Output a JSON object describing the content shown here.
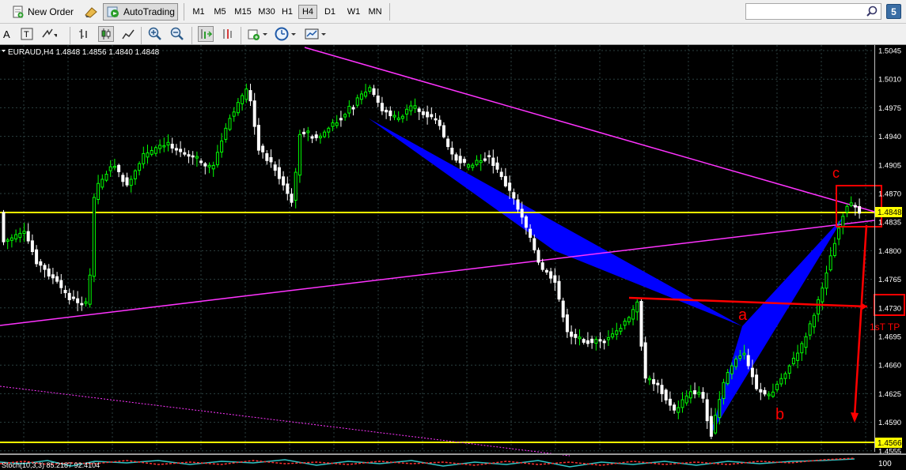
{
  "toolbar": {
    "new_order": "New Order",
    "autotrading": "AutoTrading",
    "timeframes": [
      "M1",
      "M5",
      "M15",
      "M30",
      "H1",
      "H4",
      "D1",
      "W1",
      "MN"
    ],
    "active_timeframe": "H4",
    "search_placeholder": "",
    "notification_count": "5"
  },
  "chart": {
    "header": "EURAUD,H4  1.4848 1.4856 1.4840 1.4848",
    "bid_label": "1.4848",
    "support_label": "1.4566",
    "price_labels": [
      "1.5045",
      "1.5010",
      "1.4975",
      "1.4940",
      "1.4905",
      "1.4870",
      "1.4835",
      "1.4800",
      "1.4765",
      "1.4730",
      "1.4695",
      "1.4660",
      "1.4625",
      "1.4590",
      "1.4555"
    ],
    "annotations": {
      "c": "c",
      "a": "a",
      "b": "b",
      "tp": "1sT TP"
    },
    "indicator_label": "Stoch(10,3,3) 85.2187 92.4104",
    "indicator_level": "100",
    "colors": {
      "bull": "#00ff00",
      "bear": "#ffffff",
      "grid": "#2b4040",
      "horizontal": "#ffff00",
      "trendline": "#ff33ff",
      "pattern": "#0000ff",
      "annotation": "#ff0000"
    }
  }
}
